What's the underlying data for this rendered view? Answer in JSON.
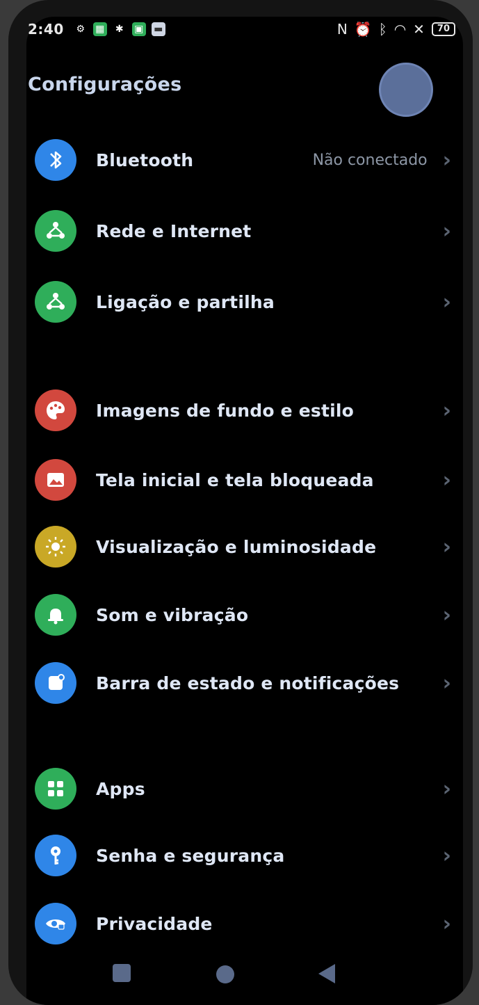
{
  "status_bar": {
    "time": "2:40",
    "battery": "70",
    "left_icons": [
      "settings-gear-icon",
      "grid-app-icon",
      "bug-icon",
      "green-app-icon",
      "message-icon"
    ],
    "right_icons": [
      "nfc-icon",
      "alarm-icon",
      "bluetooth-icon",
      "wifi-icon",
      "data-icon"
    ]
  },
  "header": {
    "title": "Configurações"
  },
  "settings": [
    {
      "label": "Bluetooth",
      "sub": "Não conectado",
      "icon": "bluetooth-icon",
      "color": "#2f86e8"
    },
    {
      "label": "Rede e Internet",
      "sub": "",
      "icon": "network-icon",
      "color": "#2fae5a"
    },
    {
      "label": "Ligação e partilha",
      "sub": "",
      "icon": "share-icon",
      "color": "#2fae5a"
    },
    {
      "label": "Imagens de fundo e estilo",
      "sub": "",
      "icon": "palette-icon",
      "color": "#d2483e"
    },
    {
      "label": "Tela inicial e tela bloqueada",
      "sub": "",
      "icon": "image-icon",
      "color": "#d2483e"
    },
    {
      "label": "Visualização e luminosidade",
      "sub": "",
      "icon": "sun-icon",
      "color": "#c9a826"
    },
    {
      "label": "Som e vibração",
      "sub": "",
      "icon": "bell-icon",
      "color": "#2fae5a"
    },
    {
      "label": "Barra de estado e notificações",
      "sub": "",
      "icon": "notification-icon",
      "color": "#2f86e8"
    },
    {
      "label": "Apps",
      "sub": "",
      "icon": "apps-icon",
      "color": "#2fae5a"
    },
    {
      "label": "Senha e segurança",
      "sub": "",
      "icon": "key-icon",
      "color": "#2f86e8"
    },
    {
      "label": "Privacidade",
      "sub": "",
      "icon": "privacy-icon",
      "color": "#2f86e8"
    }
  ],
  "nav": {
    "recent": "recent-apps-button",
    "home": "home-button",
    "back": "back-button"
  }
}
